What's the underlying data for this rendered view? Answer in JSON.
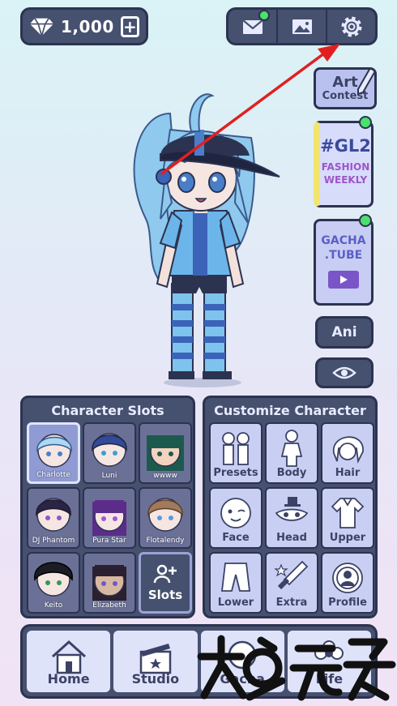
{
  "currency": {
    "gems": "1,000",
    "add_label": "+"
  },
  "top_tools": [
    "mail-icon",
    "gallery-icon",
    "settings-icon"
  ],
  "side": {
    "art_line1": "Art",
    "art_line2": "Contest",
    "gl2_title": "#GL2",
    "gl2_sub1": "FASHION",
    "gl2_sub2": "WEEKLY",
    "tube_line1": "GACHA",
    "tube_line2": ".TUBE",
    "ani_label": "Ani"
  },
  "slots_panel": {
    "title": "Character Slots",
    "slots": [
      "Charlotte",
      "Luni",
      "wwww",
      "DJ Phantom",
      "Pura Star",
      "Flotalendy",
      "Keito",
      "Elizabeth"
    ],
    "slots_button": "Slots"
  },
  "custom_panel": {
    "title": "Customize Character",
    "items": [
      "Presets",
      "Body",
      "Hair",
      "Face",
      "Head",
      "Upper",
      "Lower",
      "Extra",
      "Profile"
    ]
  },
  "nav": {
    "items": [
      "Home",
      "Studio",
      "Gacha",
      "Life"
    ]
  },
  "colors": {
    "panel": "#46506f",
    "border": "#2c3350",
    "tile": "#c9cff3",
    "notify": "#48e26c",
    "arrow": "#e02020"
  }
}
